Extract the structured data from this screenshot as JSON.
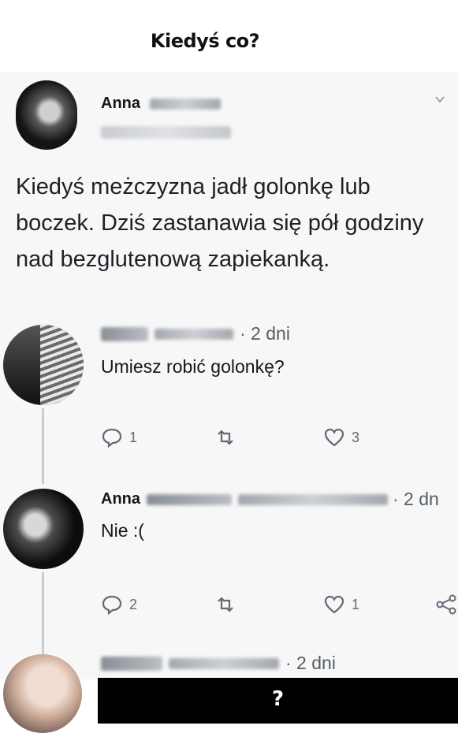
{
  "meme": {
    "title": "Kiedyś co?",
    "footer": "?"
  },
  "main_tweet": {
    "author": "Anna",
    "text": "Kiedyś meżczyzna jadł golonkę lub boczek. Dziś zastanawia się pół godziny nad bezglutenową zapiekanką."
  },
  "replies": [
    {
      "time": "· 2 dni",
      "text": "Umiesz robić golonkę?",
      "reply_count": "1",
      "like_count": "3"
    },
    {
      "author": "Anna",
      "time": "· 2 dn",
      "text": "Nie :(",
      "reply_count": "2",
      "like_count": "1"
    },
    {
      "time": "· 2 dni"
    }
  ],
  "colors": {
    "text": "#14171a",
    "meta": "#555e66",
    "icon": "#5f6b75"
  }
}
